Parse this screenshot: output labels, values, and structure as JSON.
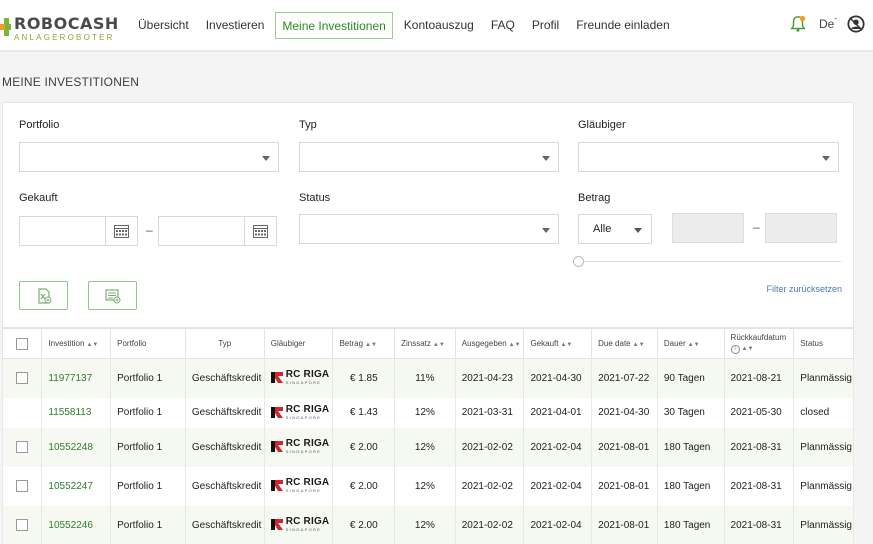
{
  "header": {
    "brand": "ROBOCASH",
    "brand_sub": "ANLAGEROBOTER",
    "nav": [
      {
        "label": "Übersicht",
        "active": false
      },
      {
        "label": "Investieren",
        "active": false
      },
      {
        "label": "Meine Investitionen",
        "active": true
      },
      {
        "label": "Kontoauszug",
        "active": false
      },
      {
        "label": "FAQ",
        "active": false
      },
      {
        "label": "Profil",
        "active": false
      },
      {
        "label": "Freunde einladen",
        "active": false
      }
    ],
    "language": "De",
    "colors": {
      "accent": "#2f8a2b",
      "logo_orange": "#f0a020",
      "logo_green": "#7db43a"
    }
  },
  "page_title": "MEINE INVESTITIONEN",
  "filters": {
    "portfolio_label": "Portfolio",
    "typ_label": "Typ",
    "glaeubiger_label": "Gläubiger",
    "gekauft_label": "Gekauft",
    "status_label": "Status",
    "betrag_label": "Betrag",
    "betrag_select": "Alle",
    "date_separator": "–",
    "amount_separator": "–",
    "reset_link": "Filter zurücksetzen"
  },
  "table": {
    "headers": [
      "Investition",
      "Portfolio",
      "Typ",
      "Gläubiger",
      "Betrag",
      "Zinssatz",
      "Ausgegeben",
      "Gekauft",
      "Due date",
      "Dauer",
      "Rückkaufdatum",
      "Status"
    ],
    "lender_main": "RC RIGA",
    "lender_sub": "SINGAPORE",
    "rows": [
      {
        "checkbox": true,
        "id": "11977137",
        "portfolio": "Portfolio 1",
        "typ": "Geschäftskredit",
        "betrag": "€ 1.85",
        "zins": "11%",
        "ausgegeben": "2021-04-23",
        "gekauft": "2021-04-30",
        "due": "2021-07-22",
        "dauer": "90 Tagen",
        "rueckkauf": "2021-08-21",
        "status": "Planmässig"
      },
      {
        "checkbox": false,
        "id": "11558113",
        "portfolio": "Portfolio 1",
        "typ": "Geschäftskredit",
        "betrag": "€ 1.43",
        "zins": "12%",
        "ausgegeben": "2021-03-31",
        "gekauft": "2021-04-01",
        "due": "2021-04-30",
        "dauer": "30 Tagen",
        "rueckkauf": "2021-05-30",
        "status": "closed"
      },
      {
        "checkbox": true,
        "id": "10552248",
        "portfolio": "Portfolio 1",
        "typ": "Geschäftskredit",
        "betrag": "€ 2.00",
        "zins": "12%",
        "ausgegeben": "2021-02-02",
        "gekauft": "2021-02-04",
        "due": "2021-08-01",
        "dauer": "180 Tagen",
        "rueckkauf": "2021-08-31",
        "status": "Planmässig"
      },
      {
        "checkbox": true,
        "id": "10552247",
        "portfolio": "Portfolio 1",
        "typ": "Geschäftskredit",
        "betrag": "€ 2.00",
        "zins": "12%",
        "ausgegeben": "2021-02-02",
        "gekauft": "2021-02-04",
        "due": "2021-08-01",
        "dauer": "180 Tagen",
        "rueckkauf": "2021-08-31",
        "status": "Planmässig"
      },
      {
        "checkbox": true,
        "id": "10552246",
        "portfolio": "Portfolio 1",
        "typ": "Geschäftskredit",
        "betrag": "€ 2.00",
        "zins": "12%",
        "ausgegeben": "2021-02-02",
        "gekauft": "2021-02-04",
        "due": "2021-08-01",
        "dauer": "180 Tagen",
        "rueckkauf": "2021-08-31",
        "status": "Planmässig"
      }
    ]
  }
}
